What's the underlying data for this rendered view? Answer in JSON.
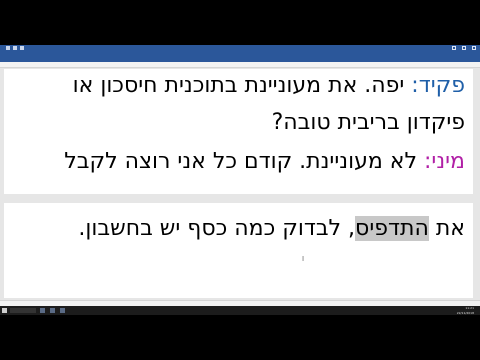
{
  "document": {
    "lines": [
      {
        "speaker": "פקיד:",
        "speaker_color": "#1f5fa8",
        "text": " יפה. את מעוניינת בתוכנית חיסכון או"
      },
      {
        "text": "פיקדון בריבית טובה?"
      },
      {
        "speaker": "מיני:",
        "speaker_color": "#b11fa6",
        "text": " לא מעוניינת. קודם כל אני רוצה לקבל"
      },
      {
        "highlight": "התדפיס",
        "before": "את ",
        "text": ", לבדוק כמה כסף יש בחשבון."
      }
    ]
  },
  "taskbar": {
    "time": "11:21",
    "date": "22/11/2018"
  },
  "colors": {
    "ribbon": "#2b579a",
    "highlight": "#c8c8c8"
  },
  "icons": [
    "word-icon",
    "windows-start-icon",
    "search-icon"
  ]
}
